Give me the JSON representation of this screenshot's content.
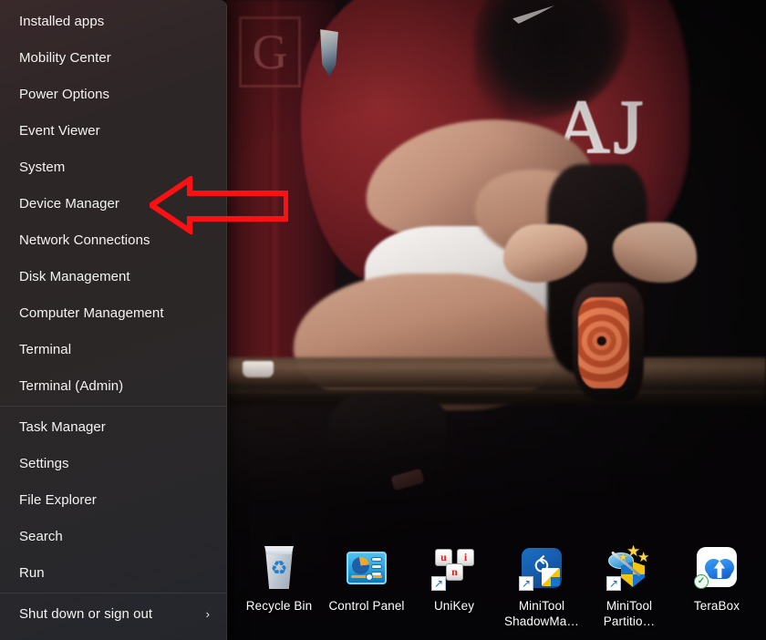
{
  "os": {
    "accent_red": "#fb1113",
    "menu_bg": "#2e2828",
    "label_color": "#f4f3f2"
  },
  "winx_menu": {
    "name": "win-x-quick-link-menu",
    "groups": [
      {
        "items": [
          {
            "label": "Installed apps",
            "name": "menu-item-installed-apps",
            "chevron": ""
          },
          {
            "label": "Mobility Center",
            "name": "menu-item-mobility-center",
            "chevron": ""
          },
          {
            "label": "Power Options",
            "name": "menu-item-power-options",
            "chevron": ""
          },
          {
            "label": "Event Viewer",
            "name": "menu-item-event-viewer",
            "chevron": ""
          },
          {
            "label": "System",
            "name": "menu-item-system",
            "chevron": ""
          },
          {
            "label": "Device Manager",
            "name": "menu-item-device-manager",
            "chevron": ""
          },
          {
            "label": "Network Connections",
            "name": "menu-item-network-connections",
            "chevron": ""
          },
          {
            "label": "Disk Management",
            "name": "menu-item-disk-management",
            "chevron": ""
          },
          {
            "label": "Computer Management",
            "name": "menu-item-computer-management",
            "chevron": ""
          },
          {
            "label": "Terminal",
            "name": "menu-item-terminal",
            "chevron": ""
          },
          {
            "label": "Terminal (Admin)",
            "name": "menu-item-terminal-admin",
            "chevron": ""
          }
        ]
      },
      {
        "items": [
          {
            "label": "Task Manager",
            "name": "menu-item-task-manager",
            "chevron": ""
          },
          {
            "label": "Settings",
            "name": "menu-item-settings",
            "chevron": ""
          },
          {
            "label": "File Explorer",
            "name": "menu-item-file-explorer",
            "chevron": ""
          },
          {
            "label": "Search",
            "name": "menu-item-search",
            "chevron": ""
          },
          {
            "label": "Run",
            "name": "menu-item-run",
            "chevron": ""
          }
        ]
      },
      {
        "items": [
          {
            "label": "Shut down or sign out",
            "name": "menu-item-shut-down-or-sign-out",
            "chevron": "›"
          }
        ]
      }
    ]
  },
  "annotation": {
    "type": "arrow",
    "name": "red-arrow-annotation",
    "direction": "left",
    "color": "#fb1113",
    "points_at": "Device Manager",
    "filled": false
  },
  "desktop": {
    "icons": [
      {
        "label": "Recycle Bin",
        "name": "desktop-icon-recycle-bin",
        "glyph": "recycle-bin-icon",
        "shortcut": false,
        "synced": false
      },
      {
        "label": "Control Panel",
        "name": "desktop-icon-control-panel",
        "glyph": "control-panel-icon",
        "shortcut": false,
        "synced": false
      },
      {
        "label": "UniKey",
        "name": "desktop-icon-unikey",
        "glyph": "unikey-icon",
        "shortcut": true,
        "synced": false
      },
      {
        "label": "MiniTool ShadowMa…",
        "name": "desktop-icon-minitool-shadowmaker",
        "glyph": "minitool-shadowmaker-icon",
        "shortcut": true,
        "synced": false
      },
      {
        "label": "MiniTool Partitio…",
        "name": "desktop-icon-minitool-partition-wizard",
        "glyph": "minitool-partition-wizard-icon",
        "shortcut": true,
        "synced": false
      },
      {
        "label": "TeraBox",
        "name": "desktop-icon-terabox",
        "glyph": "terabox-icon",
        "shortcut": false,
        "synced": true
      }
    ],
    "unikey_keys": [
      "u",
      "i",
      "n"
    ],
    "shortcut_badge_glyph": "↗",
    "sync_badge_glyph": "✓",
    "recycle_glyph": "♻"
  },
  "wallpaper": {
    "name": "desktop-wallpaper",
    "description": "Footballer in dark red jersey lacing an orange boot on a bench",
    "jersey_text": "AJ",
    "banner_text": "G"
  }
}
